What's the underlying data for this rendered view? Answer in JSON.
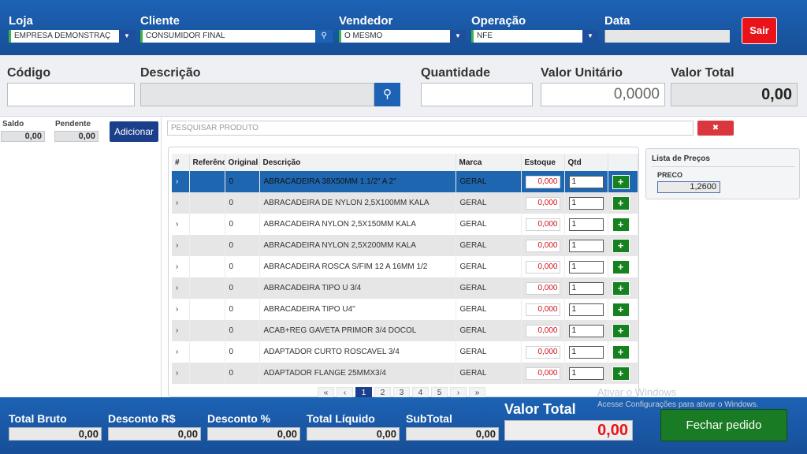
{
  "header": {
    "loja_label": "Loja",
    "loja_value": "EMPRESA DEMONSTRAÇ",
    "cliente_label": "Cliente",
    "cliente_value": "CONSUMIDOR FINAL",
    "vendedor_label": "Vendedor",
    "vendedor_value": "O MESMO",
    "operacao_label": "Operação",
    "operacao_value": "NFE",
    "data_label": "Data",
    "data_value": "",
    "sair_label": "Sair"
  },
  "entry": {
    "codigo_label": "Código",
    "codigo_value": "",
    "descricao_label": "Descrição",
    "descricao_value": "",
    "quantidade_label": "Quantidade",
    "quantidade_value": "",
    "valor_unitario_label": "Valor Unitário",
    "valor_unitario_value": "0,0000",
    "valor_total_label": "Valor Total",
    "valor_total_value": "0,00"
  },
  "left": {
    "saldo_label": "Saldo",
    "saldo_value": "0,00",
    "pendente_label": "Pendente",
    "pendente_value": "0,00",
    "adicionar_label": "Adicionar"
  },
  "search": {
    "placeholder": "PESQUISAR PRODUTO",
    "clear_icon": "✖"
  },
  "table": {
    "headers": [
      "#",
      "Referência",
      "Original",
      "Descrição",
      "Marca",
      "Estoque",
      "Qtd",
      ""
    ],
    "rows": [
      {
        "arrow": "›",
        "ref": "",
        "original": "0",
        "descricao": "ABRACADEIRA 38X50MM 1.1/2\" A 2\"",
        "marca": "GERAL",
        "estoque": "0,000",
        "qtd": "1"
      },
      {
        "arrow": "›",
        "ref": "",
        "original": "0",
        "descricao": "ABRACADEIRA DE NYLON 2,5X100MM KALA",
        "marca": "GERAL",
        "estoque": "0,000",
        "qtd": "1"
      },
      {
        "arrow": "›",
        "ref": "",
        "original": "0",
        "descricao": "ABRACADEIRA NYLON 2,5X150MM KALA",
        "marca": "GERAL",
        "estoque": "0,000",
        "qtd": "1"
      },
      {
        "arrow": "›",
        "ref": "",
        "original": "0",
        "descricao": "ABRACADEIRA NYLON 2,5X200MM KALA",
        "marca": "GERAL",
        "estoque": "0,000",
        "qtd": "1"
      },
      {
        "arrow": "›",
        "ref": "",
        "original": "0",
        "descricao": "ABRACADEIRA ROSCA S/FIM 12 A 16MM 1/2",
        "marca": "GERAL",
        "estoque": "0,000",
        "qtd": "1"
      },
      {
        "arrow": "›",
        "ref": "",
        "original": "0",
        "descricao": "ABRACADEIRA TIPO U 3/4",
        "marca": "GERAL",
        "estoque": "0,000",
        "qtd": "1"
      },
      {
        "arrow": "›",
        "ref": "",
        "original": "0",
        "descricao": "ABRACADEIRA TIPO U4\"",
        "marca": "GERAL",
        "estoque": "0,000",
        "qtd": "1"
      },
      {
        "arrow": "›",
        "ref": "",
        "original": "0",
        "descricao": "ACAB+REG GAVETA PRIMOR 3/4 DOCOL",
        "marca": "GERAL",
        "estoque": "0,000",
        "qtd": "1"
      },
      {
        "arrow": "›",
        "ref": "",
        "original": "0",
        "descricao": "ADAPTADOR CURTO ROSCAVEL 3/4",
        "marca": "GERAL",
        "estoque": "0,000",
        "qtd": "1"
      },
      {
        "arrow": "›",
        "ref": "",
        "original": "0",
        "descricao": "ADAPTADOR FLANGE 25MMX3/4",
        "marca": "GERAL",
        "estoque": "0,000",
        "qtd": "1"
      }
    ],
    "add_icon": "+"
  },
  "pager": [
    "«",
    "‹",
    "1",
    "2",
    "3",
    "4",
    "5",
    "›",
    "»"
  ],
  "pager_active": "1",
  "price_list": {
    "title": "Lista de Preços",
    "label": "PRECO",
    "value": "1,2600"
  },
  "footer": {
    "total_bruto_label": "Total Bruto",
    "total_bruto_value": "0,00",
    "desconto_rs_label": "Desconto R$",
    "desconto_rs_value": "0,00",
    "desconto_pct_label": "Desconto %",
    "desconto_pct_value": "0,00",
    "total_liquido_label": "Total Líquido",
    "total_liquido_value": "0,00",
    "subtotal_label": "SubTotal",
    "subtotal_value": "0,00",
    "valor_total_label": "Valor Total",
    "valor_total_value": "0,00",
    "fechar_label": "Fechar pedido"
  },
  "watermark": {
    "line1": "Ativar o Windows",
    "line2": "Acesse Configurações para ativar o Windows."
  },
  "colors": {
    "header_blue": "#1d62b4",
    "danger_red": "#e8141a",
    "success_green": "#197b23",
    "navy": "#1b3f8b"
  }
}
